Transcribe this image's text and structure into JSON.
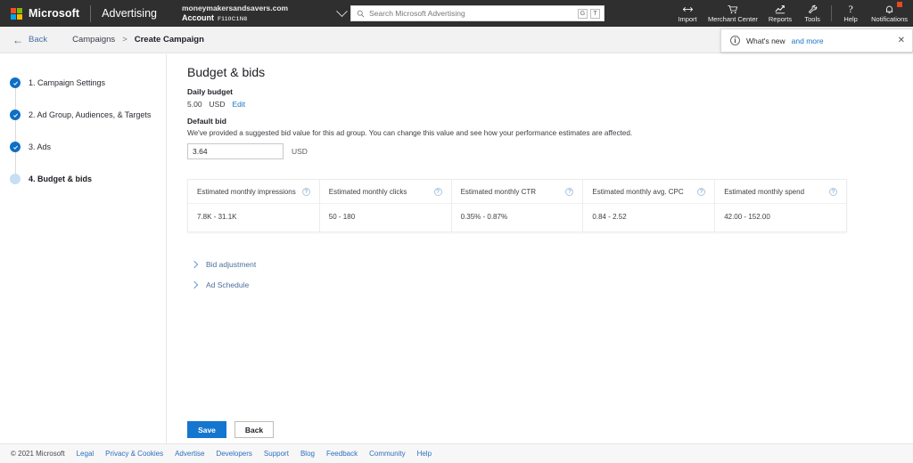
{
  "header": {
    "brand": "Microsoft",
    "product": "Advertising",
    "account": {
      "domain": "moneymakersandsavers.com",
      "label": "Account",
      "id": "F110C1N8",
      "chevron_icon": "chevron-down-icon"
    },
    "search": {
      "placeholder": "Search Microsoft Advertising",
      "value": "",
      "icon": "search-icon",
      "shortcut_keys": [
        "G",
        "T"
      ]
    },
    "tools": [
      {
        "label": "Import",
        "icon": "import-arrow-icon"
      },
      {
        "label": "Merchant Center",
        "icon": "shopping-cart-icon"
      },
      {
        "label": "Reports",
        "icon": "chart-line-icon"
      },
      {
        "label": "Tools",
        "icon": "wrench-icon"
      },
      {
        "label": "Help",
        "icon": "question-mark-icon"
      },
      {
        "label": "Notifications",
        "icon": "bell-icon"
      }
    ]
  },
  "breadcrumb": {
    "back_label": "Back",
    "back_icon": "arrow-left-icon",
    "parent": "Campaigns",
    "separator": ">",
    "current": "Create Campaign"
  },
  "whats_new": {
    "icon": "info-circle-icon",
    "text": "What's new",
    "link": "and more",
    "close_icon": "close-icon"
  },
  "stepper": {
    "steps": [
      {
        "label": "1. Campaign Settings",
        "state": "done",
        "icon": "check-circle-icon"
      },
      {
        "label": "2. Ad Group, Audiences, & Targets",
        "state": "done",
        "icon": "check-circle-icon"
      },
      {
        "label": "3. Ads",
        "state": "done",
        "icon": "check-circle-icon"
      },
      {
        "label": "4. Budget & bids",
        "state": "active",
        "icon": "circle-icon"
      }
    ]
  },
  "main": {
    "title": "Budget & bids",
    "daily_budget": {
      "label": "Daily budget",
      "amount": "5.00",
      "currency": "USD",
      "edit_label": "Edit"
    },
    "default_bid": {
      "label": "Default bid",
      "helper": "We've provided a suggested bid value for this ad group. You can change this value and see how your performance estimates are affected.",
      "value": "3.64",
      "currency": "USD"
    },
    "estimates": {
      "columns": [
        {
          "header": "Estimated monthly impressions",
          "value": "7.8K - 31.1K",
          "info_icon": "question-circle-icon"
        },
        {
          "header": "Estimated monthly clicks",
          "value": "50 - 180",
          "info_icon": "question-circle-icon"
        },
        {
          "header": "Estimated monthly CTR",
          "value": "0.35% - 0.87%",
          "info_icon": "question-circle-icon"
        },
        {
          "header": "Estimated monthly avg. CPC",
          "value": "0.84 - 2.52",
          "info_icon": "question-circle-icon"
        },
        {
          "header": "Estimated monthly spend",
          "value": "42.00 - 152.00",
          "info_icon": "question-circle-icon"
        }
      ]
    },
    "collapsibles": [
      {
        "label": "Bid adjustment",
        "icon": "chevron-right-icon"
      },
      {
        "label": "Ad Schedule",
        "icon": "chevron-right-icon"
      }
    ],
    "actions": {
      "save_label": "Save",
      "back_label": "Back"
    }
  },
  "footer": {
    "copyright": "© 2021 Microsoft",
    "links": [
      "Legal",
      "Privacy & Cookies",
      "Advertise",
      "Developers",
      "Support",
      "Blog",
      "Feedback",
      "Community",
      "Help"
    ]
  },
  "colors": {
    "header_bg": "#2f2f2f",
    "accent_blue": "#1576cf",
    "link_blue": "#2f6fc0",
    "step_done": "#0f6fc5",
    "step_active": "#c5dff5",
    "badge": "#e8491f"
  }
}
